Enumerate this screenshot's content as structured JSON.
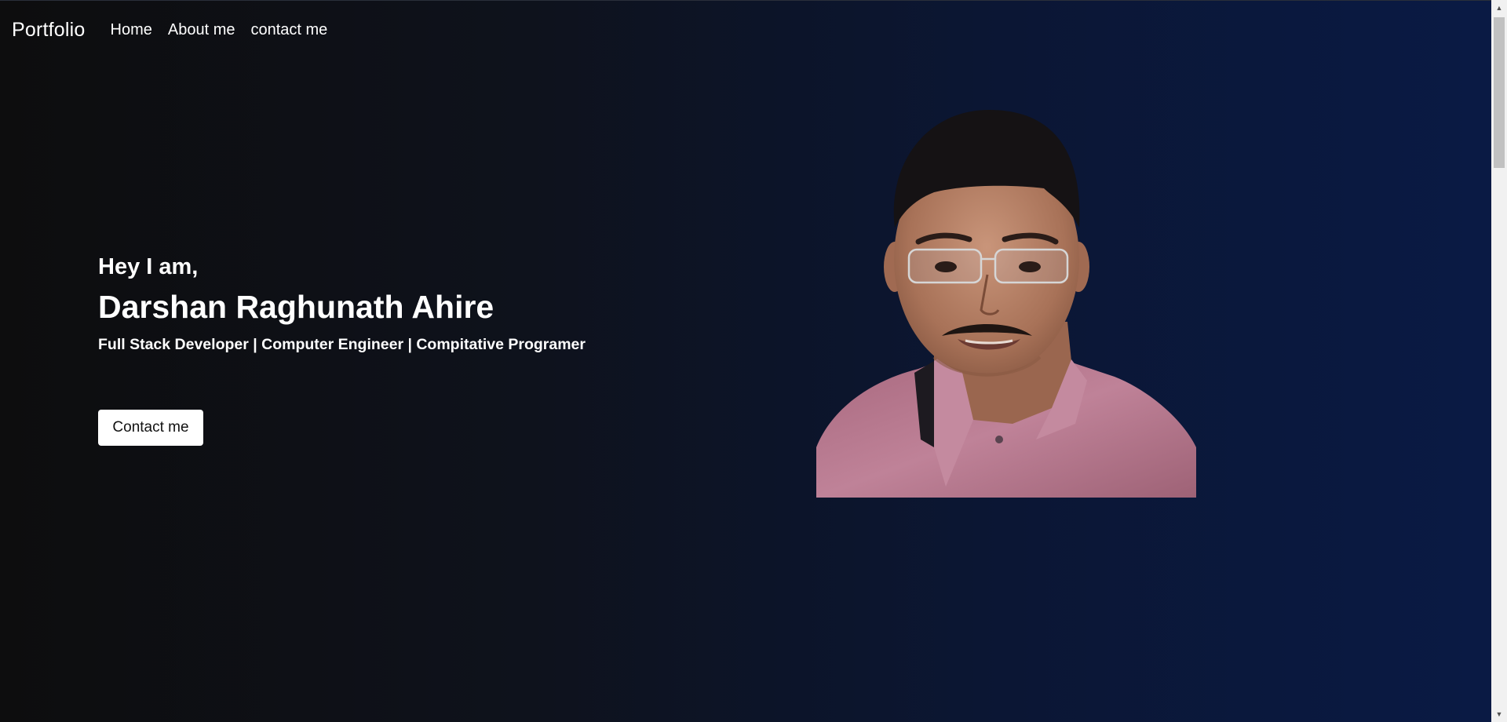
{
  "navbar": {
    "brand": "Portfolio",
    "links": [
      {
        "label": "Home"
      },
      {
        "label": "About me"
      },
      {
        "label": "contact me"
      }
    ]
  },
  "hero": {
    "greeting": "Hey I am,",
    "name": "Darshan Raghunath Ahire",
    "tagline": "Full Stack Developer | Computer Engineer | Compitative Programer",
    "button_label": "Contact me"
  },
  "colors": {
    "background_start": "#0d0d0e",
    "background_end": "#0a1a45",
    "button_bg": "#ffffff",
    "shirt": "#b97b8f"
  },
  "icons": {
    "scroll_up": "▲",
    "scroll_down": "▼"
  }
}
